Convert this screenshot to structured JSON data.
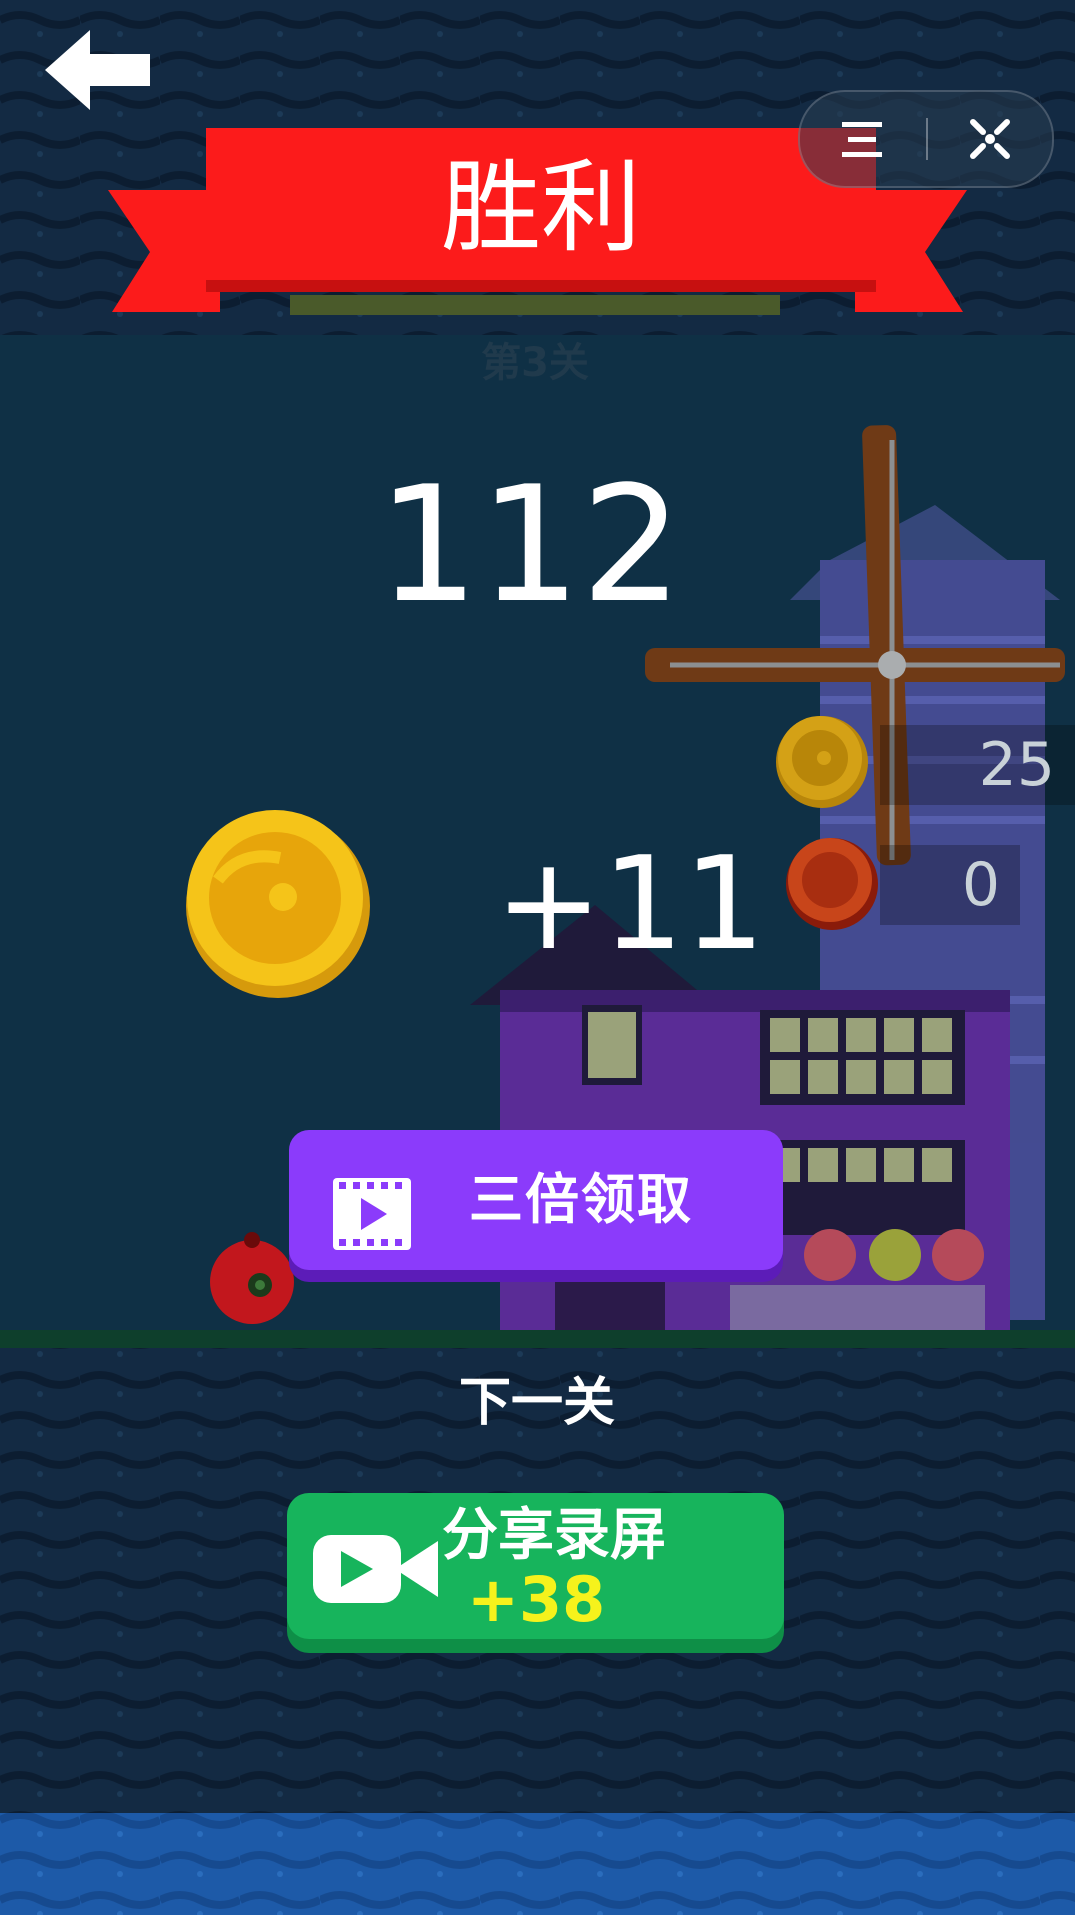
{
  "header": {
    "title": "胜利",
    "level": "第3关"
  },
  "result": {
    "score": "112",
    "reward": "+11"
  },
  "currency": {
    "gold_count": "25",
    "red_count": "0"
  },
  "buttons": {
    "triple_claim": "三倍领取",
    "next_level": "下一关",
    "share_record": "分享录屏",
    "share_bonus": "+38"
  },
  "icons": {
    "back": "back-arrow-icon",
    "menu": "menu-icon",
    "close": "close-icon",
    "video": "video-play-icon",
    "camera": "video-camera-icon"
  },
  "colors": {
    "banner_red": "#fc1b1b",
    "triple_button": "#8b3bfb",
    "share_button": "#17b45c",
    "bonus_yellow": "#f6f21c"
  }
}
